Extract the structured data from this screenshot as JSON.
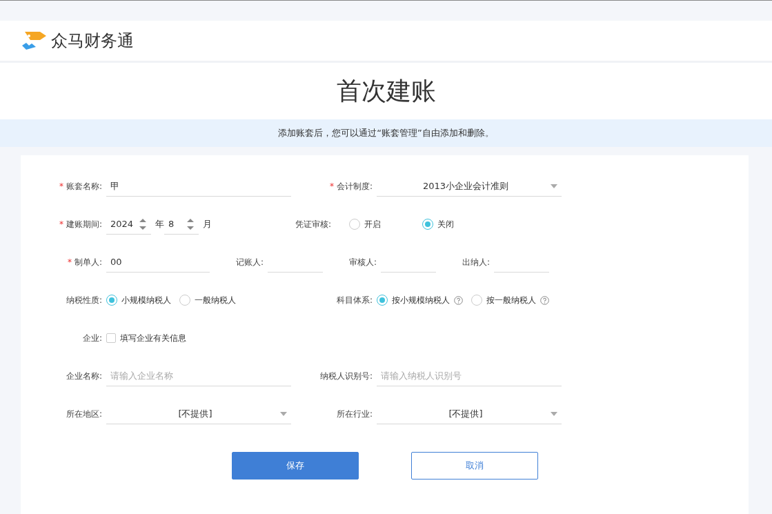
{
  "header": {
    "logo_text": "众马财务通"
  },
  "page_title": "首次建账",
  "notice": "添加账套后，您可以通过“账套管理”自由添加和删除。",
  "form": {
    "account_name": {
      "marker": "*",
      "label": "账套名称:",
      "value": "甲"
    },
    "accounting_system": {
      "marker": "*",
      "label": "会计制度:",
      "value": "2013小企业会计准则"
    },
    "period": {
      "marker": "*",
      "label": "建账期间:",
      "year": "2024",
      "year_unit": "年",
      "month": "8",
      "month_unit": "月"
    },
    "voucher_review": {
      "label": "凭证审核:",
      "options": [
        {
          "label": "开启",
          "selected": false
        },
        {
          "label": "关闭",
          "selected": true
        }
      ]
    },
    "preparer": {
      "marker": "*",
      "label": "制单人:",
      "value": "00"
    },
    "bookkeeper": {
      "label": "记账人:"
    },
    "reviewer": {
      "label": "审核人:"
    },
    "cashier": {
      "label": "出纳人:"
    },
    "taxpayer_type": {
      "label": "纳税性质:",
      "options": [
        {
          "label": "小规模纳税人",
          "selected": true
        },
        {
          "label": "一般纳税人",
          "selected": false
        }
      ]
    },
    "subject_system": {
      "label": "科目体系:",
      "options": [
        {
          "label": "按小规模纳税人",
          "selected": true,
          "help": true
        },
        {
          "label": "按一般纳税人",
          "selected": false,
          "help": true
        }
      ]
    },
    "enterprise": {
      "label": "企业:",
      "checkbox": {
        "label": "填写企业有关信息",
        "checked": false
      }
    },
    "enterprise_name": {
      "label": "企业名称:",
      "placeholder": "请输入企业名称"
    },
    "tax_id": {
      "label": "纳税人识别号:",
      "placeholder": "请输入纳税人识别号"
    },
    "region": {
      "label": "所在地区:",
      "value": "[不提供]"
    },
    "industry": {
      "label": "所在行业:",
      "value": "[不提供]"
    }
  },
  "buttons": [
    {
      "label": "保存",
      "kind": "primary"
    },
    {
      "label": "取消",
      "kind": "secondary"
    }
  ]
}
